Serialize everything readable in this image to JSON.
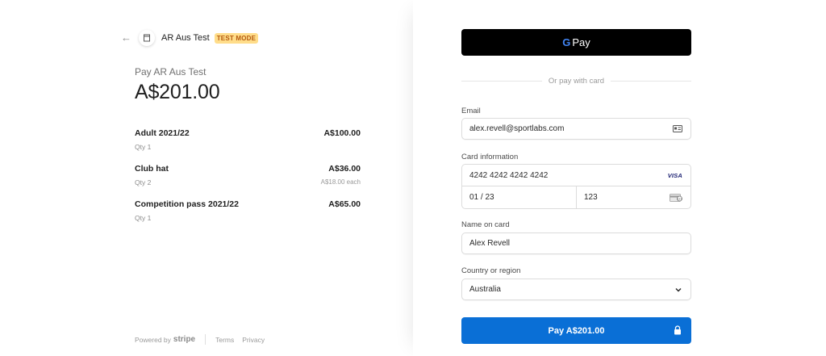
{
  "merchant": {
    "name": "AR Aus Test",
    "badge": "TEST MODE"
  },
  "summary": {
    "pay_to": "Pay AR Aus Test",
    "total": "A$201.00"
  },
  "line_items": [
    {
      "name": "Adult 2021/22",
      "qty": "Qty 1",
      "price": "A$100.00",
      "each": ""
    },
    {
      "name": "Club hat",
      "qty": "Qty 2",
      "price": "A$36.00",
      "each": "A$18.00 each"
    },
    {
      "name": "Competition pass 2021/22",
      "qty": "Qty 1",
      "price": "A$65.00",
      "each": ""
    }
  ],
  "footer": {
    "powered_by": "Powered by",
    "brand": "stripe",
    "terms": "Terms",
    "privacy": "Privacy"
  },
  "gpay": {
    "g": "G",
    "label": "Pay"
  },
  "divider_text": "Or pay with card",
  "form": {
    "email_label": "Email",
    "email_value": "alex.revell@sportlabs.com",
    "card_label": "Card information",
    "card_number": "4242 4242 4242 4242",
    "card_brand": "VISA",
    "card_expiry": "01 / 23",
    "card_cvc": "123",
    "name_label": "Name on card",
    "name_value": "Alex Revell",
    "country_label": "Country or region",
    "country_value": "Australia"
  },
  "pay_button": {
    "label": "Pay A$201.00"
  },
  "icons": {
    "back": "arrow-left-icon",
    "logo": "store-icon",
    "contact": "contact-card-icon",
    "cvc": "card-cvc-icon",
    "chevron": "chevron-down-icon",
    "lock": "lock-icon"
  },
  "colors": {
    "pay_button": "#0a6fd6",
    "gpay_button": "#000000",
    "badge_bg": "#ffdd8a",
    "badge_text": "#b45a0f"
  }
}
